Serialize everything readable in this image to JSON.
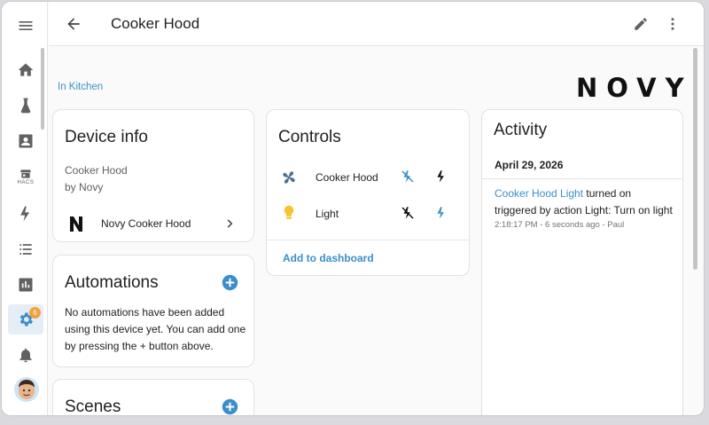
{
  "header": {
    "title": "Cooker Hood"
  },
  "sidebar": {
    "items": [
      {
        "name": "menu-icon"
      },
      {
        "name": "home-icon"
      },
      {
        "name": "flask-icon"
      },
      {
        "name": "contacts-icon"
      },
      {
        "name": "store-icon",
        "label": "HACS"
      },
      {
        "name": "energy-icon"
      },
      {
        "name": "list-icon"
      },
      {
        "name": "chart-icon"
      },
      {
        "name": "settings-icon",
        "badge": "6"
      },
      {
        "name": "bell-icon"
      }
    ]
  },
  "area_link": "In Kitchen",
  "brand_logo": "NOVY",
  "device_info": {
    "title": "Device info",
    "model": "Cooker Hood",
    "manufacturer": "by Novy",
    "integration_label": "Novy Cooker Hood"
  },
  "automations": {
    "title": "Automations",
    "empty_text": "No automations have been added using this device yet. You can add one by pressing the + button above."
  },
  "scenes": {
    "title": "Scenes"
  },
  "controls": {
    "title": "Controls",
    "entities": [
      {
        "name": "Cooker Hood",
        "icon": "fan-icon"
      },
      {
        "name": "Light",
        "icon": "bulb-icon"
      }
    ],
    "add_to_dashboard": "Add to dashboard"
  },
  "activity": {
    "title": "Activity",
    "date": "April 29, 2026",
    "entry_entity": "Cooker Hood Light",
    "entry_action": " turned on",
    "entry_trigger": "triggered by action Light: Turn on light",
    "entry_meta": "2:18:17 PM - 6 seconds ago - Paul"
  },
  "colors": {
    "accent": "#3a8fc9",
    "badge": "#f2a03a",
    "icon_gray": "#616161",
    "fan_blue": "#4d6e91",
    "bulb_yellow": "#f7c431"
  }
}
